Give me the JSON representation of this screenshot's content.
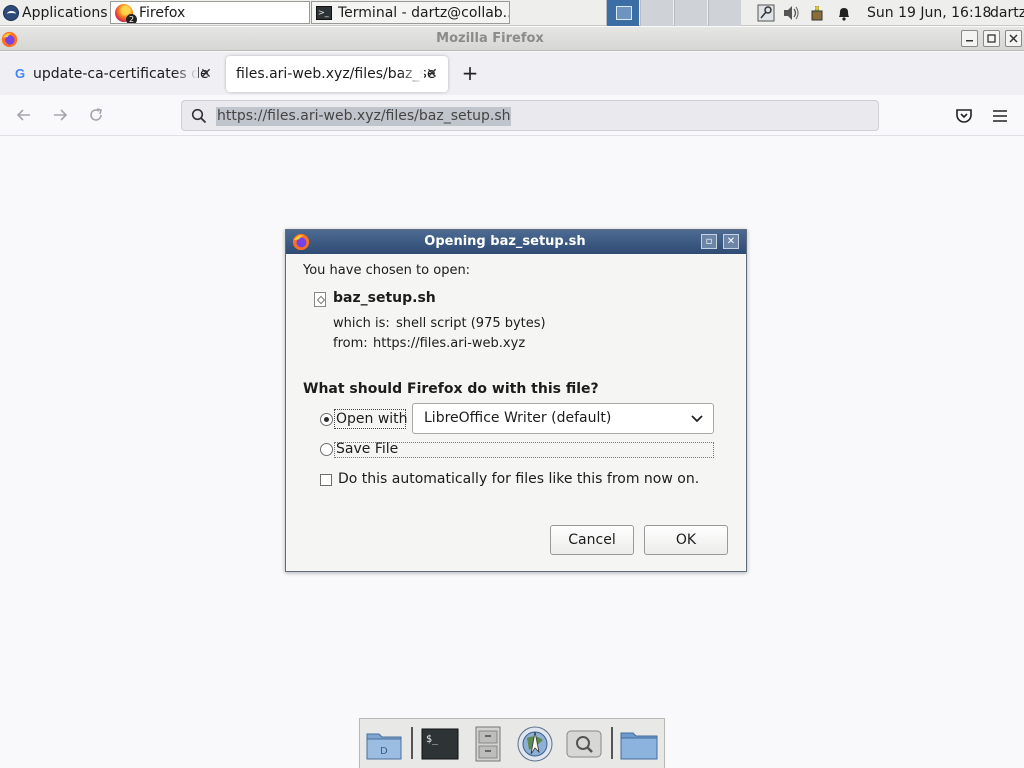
{
  "system_panel": {
    "applications_label": "Applications",
    "tasks": [
      {
        "label": "Firefox",
        "badge": "2"
      },
      {
        "label": "Terminal - dartz@collab..."
      }
    ],
    "clock": "Sun 19 Jun, 16:18",
    "user": "dartz"
  },
  "window": {
    "title": "Mozilla Firefox"
  },
  "tabs": [
    {
      "label": "update-ca-certificates de",
      "favicon": "G",
      "selected": false
    },
    {
      "label": "files.ari-web.xyz/files/baz_se",
      "selected": true
    }
  ],
  "nav": {
    "url": "https://files.ari-web.xyz/files/baz_setup.sh"
  },
  "dialog": {
    "title": "Opening baz_setup.sh",
    "intro": "You have chosen to open:",
    "file_name": "baz_setup.sh",
    "which_is_label": "which is:",
    "which_is_value": "shell script (975 bytes)",
    "from_label": "from:",
    "from_value": "https://files.ari-web.xyz",
    "question": "What should Firefox do with this file?",
    "open_with_label": "Open with",
    "open_with_app": "LibreOffice Writer (default)",
    "save_file_label": "Save File",
    "auto_label": "Do this automatically for files like this from now on.",
    "cancel_label": "Cancel",
    "ok_label": "OK",
    "selected_option": "open_with",
    "auto_checked": false
  },
  "colors": {
    "dialog_title_bar": "#3b5a84",
    "url_selection": "#c0c4cc",
    "page_background": "#f9f9fb"
  }
}
